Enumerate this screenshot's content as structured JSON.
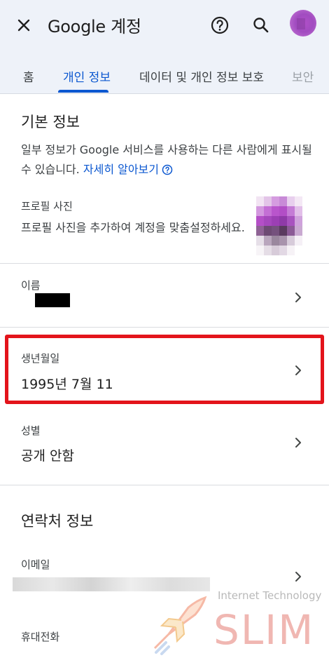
{
  "header": {
    "app_title": "Google 계정",
    "close_icon": "close-icon",
    "help_icon": "help-icon",
    "search_icon": "search-icon"
  },
  "tabs": [
    {
      "label": "홈"
    },
    {
      "label": "개인 정보",
      "active": true
    },
    {
      "label": "데이터 및 개인 정보 보호"
    },
    {
      "label": "보안"
    }
  ],
  "basic_info": {
    "title": "기본 정보",
    "description": "일부 정보가 Google 서비스를 사용하는 다른 사람에게 표시될 수 있습니다.",
    "learn_more": "자세히 알아보기",
    "photo": {
      "label": "프로필 사진",
      "desc": "프로필 사진을 추가하여 계정을 맞춤설정하세요."
    },
    "name": {
      "label": "이름"
    },
    "birthday": {
      "label": "생년월일",
      "value": "1995년 7월 11"
    },
    "gender": {
      "label": "성별",
      "value": "공개 안함"
    }
  },
  "contact_info": {
    "title": "연락처 정보",
    "email": {
      "label": "이메일"
    },
    "phone": {
      "label": "휴대전화"
    }
  },
  "watermark": {
    "line1": "Internet Technology",
    "line2": "SLIM"
  },
  "colors": {
    "accent": "#0b57d0",
    "header_bg": "#eef2f9",
    "highlight": "#e3141b"
  }
}
